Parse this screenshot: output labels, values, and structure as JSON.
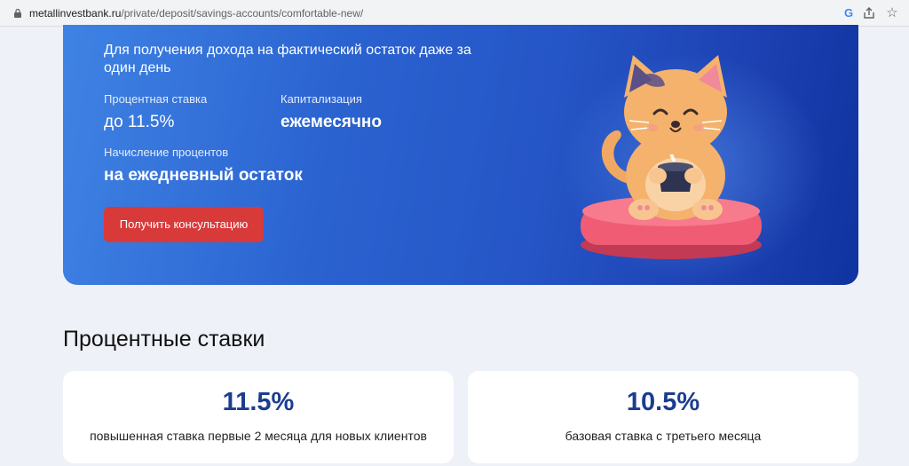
{
  "browser": {
    "url_host": "metallinvestbank.ru",
    "url_path": "/private/deposit/savings-accounts/comfortable-new/",
    "icons": [
      "lock-icon",
      "google-icon",
      "share-icon",
      "star-icon"
    ]
  },
  "hero": {
    "title": "Для получения дохода на фактический остаток даже за один день",
    "rate_label": "Процентная ставка",
    "rate_value": "до 11.5%",
    "cap_label": "Капитализация",
    "cap_value": "ежемесячно",
    "accrual_label": "Начисление процентов",
    "accrual_value": "на ежедневный остаток",
    "cta_label": "Получить консультацию",
    "illustration": "cat-on-cushion-with-cup"
  },
  "rates_section": {
    "title": "Процентные ставки",
    "cards": [
      {
        "rate": "11.5%",
        "description": "повышенная ставка первые 2 месяца для новых клиентов"
      },
      {
        "rate": "10.5%",
        "description": "базовая ставка с третьего месяца"
      }
    ]
  },
  "colors": {
    "accent_button": "#d83a3a",
    "hero_blue": "#2a62d0",
    "rate_text": "#1c3d8f",
    "page_bg": "#eef1f8"
  }
}
